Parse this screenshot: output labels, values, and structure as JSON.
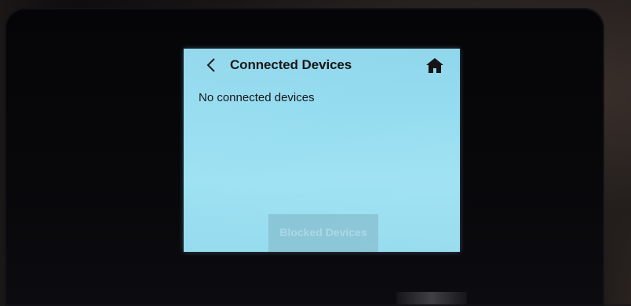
{
  "screen": {
    "background_color": "#95dcf0",
    "header": {
      "back_icon": "chevron-left-icon",
      "title": "Connected Devices",
      "home_icon": "home-icon"
    },
    "main": {
      "empty_message": "No connected devices"
    },
    "footer": {
      "blocked_devices_label": "Blocked Devices",
      "button_color": "#88c5d6"
    }
  }
}
